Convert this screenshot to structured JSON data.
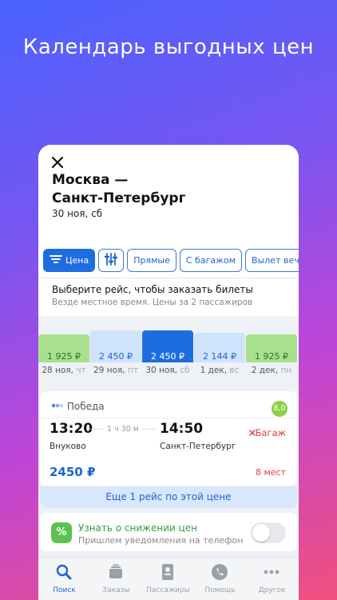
{
  "promo": {
    "title": "Календарь выгодных цен"
  },
  "header": {
    "route_line1": "Москва —",
    "route_line2": "Санкт-Петербург",
    "date": "30 ноя, сб"
  },
  "filters": [
    {
      "label": "Цена",
      "active": true,
      "icon": "sort-lines-icon"
    },
    {
      "label": "",
      "active": false,
      "icon": "sliders-icon"
    },
    {
      "label": "Прямые",
      "active": false
    },
    {
      "label": "С багажом",
      "active": false
    },
    {
      "label": "Вылет вечер",
      "active": false
    }
  ],
  "info": {
    "line1": "Выберите рейс, чтобы заказать билеты",
    "line2": "Везде местное время. Цены за 2 пассажиров"
  },
  "calendar": {
    "days": [
      {
        "price": "1 925 ₽",
        "date": "28 ноя,",
        "weekday": "чт",
        "level": 0.26,
        "color": "#a8e08e",
        "selected": false
      },
      {
        "price": "2 450 ₽",
        "date": "29 ноя,",
        "weekday": "пт",
        "level": 0.3,
        "color": "#cfe3fb",
        "selected": false
      },
      {
        "price": "2 450 ₽",
        "date": "30 ноя,",
        "weekday": "сб",
        "level": 0.3,
        "color": "#1e6de0",
        "selected": true
      },
      {
        "price": "2 144 ₽",
        "date": "1 дек,",
        "weekday": "вс",
        "level": 0.28,
        "color": "#cfe3fb",
        "selected": false
      },
      {
        "price": "1 925 ₽",
        "date": "2 дек,",
        "weekday": "пн",
        "level": 0.26,
        "color": "#a8e08e",
        "selected": false
      }
    ]
  },
  "flight": {
    "airline": "Победа",
    "rating": "8,0",
    "dep_time": "13:20",
    "arr_time": "14:50",
    "duration": "1 ч 30 м",
    "from": "Внуково",
    "to": "Санкт-Петербург",
    "baggage": "Багаж",
    "price": "2450 ₽",
    "seats": "8 мест"
  },
  "more": {
    "label": "Еще 1 рейс по этой цене"
  },
  "notify": {
    "badge": "%",
    "title": "Узнать о снижении цен",
    "subtitle": "Пришлем уведомления на телефон",
    "enabled": false
  },
  "tabs": [
    {
      "label": "Поиск",
      "icon": "search-icon",
      "active": true
    },
    {
      "label": "Заказы",
      "icon": "orders-icon",
      "active": false
    },
    {
      "label": "Пассажиры",
      "icon": "passenger-icon",
      "active": false
    },
    {
      "label": "Помощь",
      "icon": "phone-icon",
      "active": false
    },
    {
      "label": "Другое",
      "icon": "more-icon",
      "active": false
    }
  ]
}
